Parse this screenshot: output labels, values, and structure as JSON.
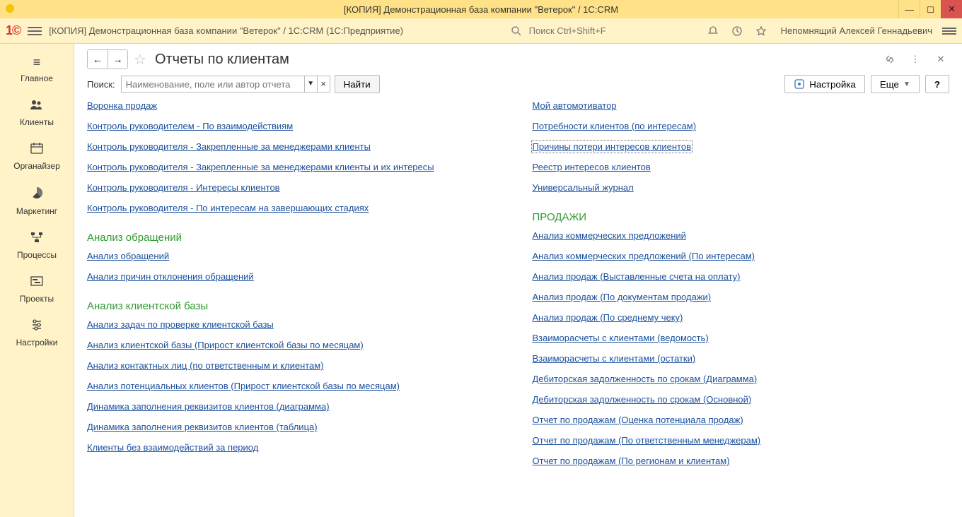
{
  "window": {
    "title": "[КОПИЯ] Демонстрационная база компании \"Ветерок\" / 1C:CRM"
  },
  "appbar": {
    "title": "[КОПИЯ] Демонстрационная база компании \"Ветерок\" / 1C:CRM  (1С:Предприятие)",
    "search_placeholder": "Поиск Ctrl+Shift+F",
    "user": "Непомнящий Алексей Геннадьевич"
  },
  "sidebar": {
    "items": [
      {
        "label": "Главное"
      },
      {
        "label": "Клиенты"
      },
      {
        "label": "Органайзер"
      },
      {
        "label": "Маркетинг"
      },
      {
        "label": "Процессы"
      },
      {
        "label": "Проекты"
      },
      {
        "label": "Настройки"
      }
    ]
  },
  "page": {
    "title": "Отчеты по клиентам",
    "search_label": "Поиск:",
    "search_placeholder": "Наименование, поле или автор отчета",
    "find_btn": "Найти",
    "settings_btn": "Настройка",
    "more_btn": "Еще",
    "help_btn": "?"
  },
  "reports": {
    "left_top": [
      "Воронка продаж",
      "Контроль руководителем -  По взаимодействиям",
      "Контроль руководителя -  Закрепленные за менеджерами клиенты",
      "Контроль руководителя -  Закрепленные за менеджерами клиенты и их интересы",
      "Контроль руководителя -  Интересы клиентов",
      "Контроль руководителя -  По интересам на завершающих стадиях"
    ],
    "right_top": [
      "Мой автомотиватор",
      "Потребности клиентов (по интересам)",
      "Причины потери интересов клиентов",
      "Реестр интересов клиентов",
      "Универсальный журнал"
    ],
    "left_sec1_title": "Анализ обращений",
    "left_sec1": [
      "Анализ обращений",
      "Анализ причин отклонения обращений"
    ],
    "right_sec1_title": "ПРОДАЖИ",
    "right_sec1": [
      "Анализ коммерческих предложений",
      "Анализ коммерческих предложений (По интересам)",
      "Анализ продаж (Выставленные счета на оплату)",
      "Анализ продаж (По документам продажи)",
      "Анализ продаж (По среднему чеку)",
      "Взаиморасчеты с клиентами (ведомость)",
      "Взаиморасчеты с клиентами (остатки)",
      "Дебиторская задолженность по срокам (Диаграмма)",
      "Дебиторская задолженность по срокам (Основной)",
      "Отчет по продажам (Оценка потенциала продаж)",
      "Отчет по продажам (По ответственным менеджерам)",
      "Отчет по продажам (По регионам и клиентам)"
    ],
    "left_sec2_title": "Анализ клиентской базы",
    "left_sec2": [
      "Анализ задач по проверке клиентской базы",
      "Анализ клиентской базы (Прирост клиентской базы по месяцам)",
      "Анализ контактных лиц (по ответственным и клиентам)",
      "Анализ потенциальных клиентов (Прирост клиентской базы по месяцам)",
      "Динамика заполнения реквизитов клиентов (диаграмма)",
      "Динамика заполнения реквизитов клиентов (таблица)",
      "Клиенты без взаимодействий за период"
    ],
    "right_selected_index": 2
  }
}
